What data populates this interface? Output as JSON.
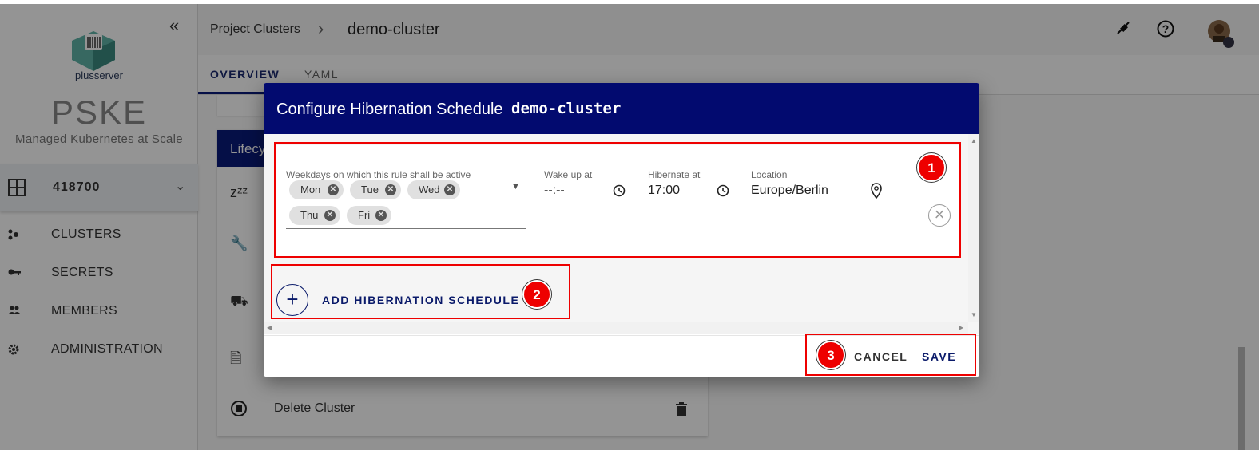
{
  "sidebar": {
    "logo_text": "plusserver",
    "brand": "PSKE",
    "tagline": "Managed Kubernetes at Scale",
    "project": "418700",
    "nav": [
      {
        "label": "CLUSTERS",
        "icon": "clusters-icon"
      },
      {
        "label": "SECRETS",
        "icon": "key-icon"
      },
      {
        "label": "MEMBERS",
        "icon": "members-icon"
      },
      {
        "label": "ADMINISTRATION",
        "icon": "gear-icon"
      }
    ]
  },
  "header": {
    "breadcrumb_parent": "Project Clusters",
    "breadcrumb_current": "demo-cluster",
    "tabs": [
      "OVERVIEW",
      "YAML"
    ]
  },
  "background_card": {
    "title": "Lifecy",
    "rows": [
      {
        "icon": "zzz-icon",
        "label": ""
      },
      {
        "icon": "wrench-icon",
        "label": ""
      },
      {
        "icon": "tractor-icon",
        "label": ""
      },
      {
        "icon": "file-refresh-icon",
        "label": ""
      },
      {
        "icon": "delete-circle-icon",
        "label": "Delete Cluster"
      }
    ]
  },
  "dialog": {
    "title": "Configure Hibernation Schedule",
    "cluster": "demo-cluster",
    "rule": {
      "weekdays_label": "Weekdays on which this rule shall be active",
      "weekdays": [
        "Mon",
        "Tue",
        "Wed",
        "Thu",
        "Fri"
      ],
      "wakeup_label": "Wake up at",
      "wakeup_value": "--:--",
      "hibernate_label": "Hibernate at",
      "hibernate_value": "17:00",
      "location_label": "Location",
      "location_value": "Europe/Berlin"
    },
    "add_label": "ADD HIBERNATION SCHEDULE",
    "cancel_label": "CANCEL",
    "save_label": "SAVE"
  },
  "annotations": [
    "1",
    "2",
    "3"
  ],
  "colors": {
    "primary": "#020a6f",
    "annotation": "#e00000"
  }
}
